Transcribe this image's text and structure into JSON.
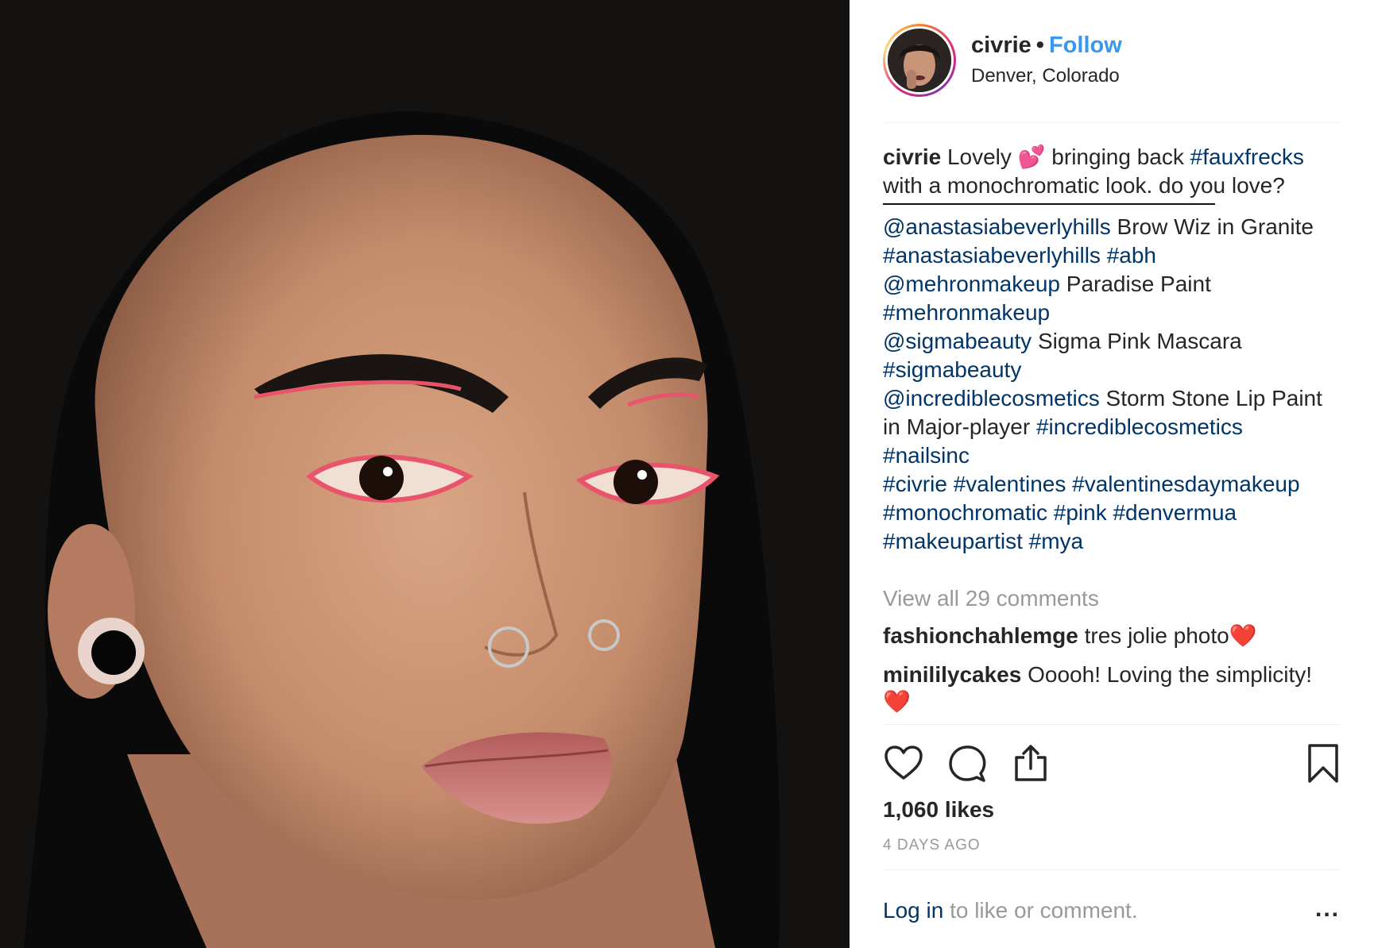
{
  "post": {
    "username": "civrie",
    "follow_label": "Follow",
    "location": "Denver, Colorado"
  },
  "caption": {
    "username": "civrie",
    "line1_text_a": " Lovely 💕  bringing back ",
    "line1_tag": "#fauxfrecks",
    "line2": "with a monochromatic look. do you love?",
    "credit1_mention": "@anastasiabeverlyhills",
    "credit1_text": " Brow Wiz in Granite",
    "credit1_tags": "#anastasiabeverlyhills #abh",
    "credit2_mention": "@mehronmakeup",
    "credit2_text": " Paradise Paint",
    "credit2_tags": "#mehronmakeup",
    "credit3_mention": "@sigmabeauty",
    "credit3_text": " Sigma Pink Mascara",
    "credit3_tags": "#sigmabeauty",
    "credit4_mention": "@incrediblecosmetics",
    "credit4_text": " Storm Stone Lip Paint",
    "credit4_line2_text": "in Major-player ",
    "credit4_line2_tag": "#incrediblecosmetics",
    "tags_line1": "#nailsinc",
    "tags_line2": "#civrie #valentines #valentinesdaymakeup",
    "tags_line3": "#monochromatic #pink #denvermua",
    "tags_line4": "#makeupartist #mya"
  },
  "comments": {
    "view_all": "View all 29 comments",
    "items": [
      {
        "user": "fashionchahlemge",
        "text": " tres jolie photo❤️"
      },
      {
        "user": "minililycakes",
        "text": " Ooooh! Loving the simplicity!",
        "text2": "❤️"
      }
    ]
  },
  "actions": {
    "like_icon": "heart-icon",
    "comment_icon": "comment-bubble-icon",
    "share_icon": "share-icon",
    "save_icon": "bookmark-icon"
  },
  "stats": {
    "likes": "1,060 likes",
    "time_ago": "4 DAYS AGO"
  },
  "footer": {
    "login_link": "Log in",
    "login_text": " to like or comment.",
    "more_label": "..."
  },
  "colors": {
    "link_blue": "#3897f0",
    "tag_navy": "#003569",
    "muted_gray": "#999999"
  }
}
